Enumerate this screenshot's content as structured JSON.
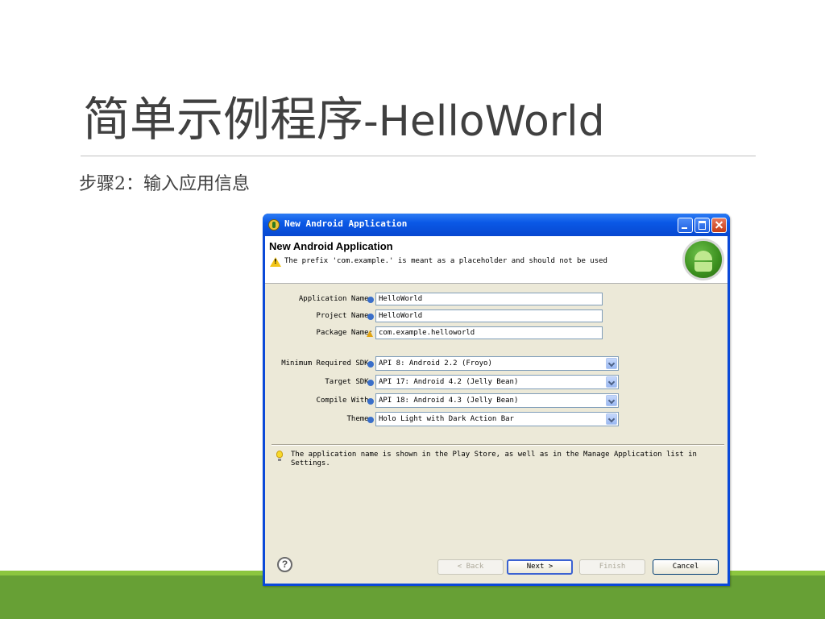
{
  "slide": {
    "title_cn": "简单示例程序",
    "title_latin": "-HelloWorld",
    "step": "步骤2：输入应用信息"
  },
  "dialog": {
    "window_title": "New Android Application",
    "header_title": "New Android Application",
    "header_message": "The prefix 'com.example.' is meant as a placeholder and should not be used",
    "fields": [
      {
        "label": "Application Name:",
        "value": "HelloWorld",
        "icon": "info-icon"
      },
      {
        "label": "Project Name:",
        "value": "HelloWorld",
        "icon": "info-icon"
      },
      {
        "label": "Package Name:",
        "value": "com.example.helloworld",
        "icon": "warning-icon"
      }
    ],
    "selects": [
      {
        "label": "Minimum Required SDK:",
        "value": "API 8: Android 2.2 (Froyo)"
      },
      {
        "label": "Target SDK:",
        "value": "API 17: Android 4.2 (Jelly Bean)"
      },
      {
        "label": "Compile With:",
        "value": "API 18: Android 4.3 (Jelly Bean)"
      },
      {
        "label": "Theme:",
        "value": "Holo Light with Dark Action Bar"
      }
    ],
    "tip": "The application name is shown in the Play Store, as well as in the Manage Application list in Settings.",
    "buttons": {
      "help": "?",
      "back": "< Back",
      "next": "Next >",
      "finish": "Finish",
      "cancel": "Cancel"
    }
  },
  "colors": {
    "titlebar": "#0a58e6",
    "dialog_bg": "#ece9d8",
    "footer_light": "#8cc63f",
    "footer_dark": "#67a035"
  }
}
